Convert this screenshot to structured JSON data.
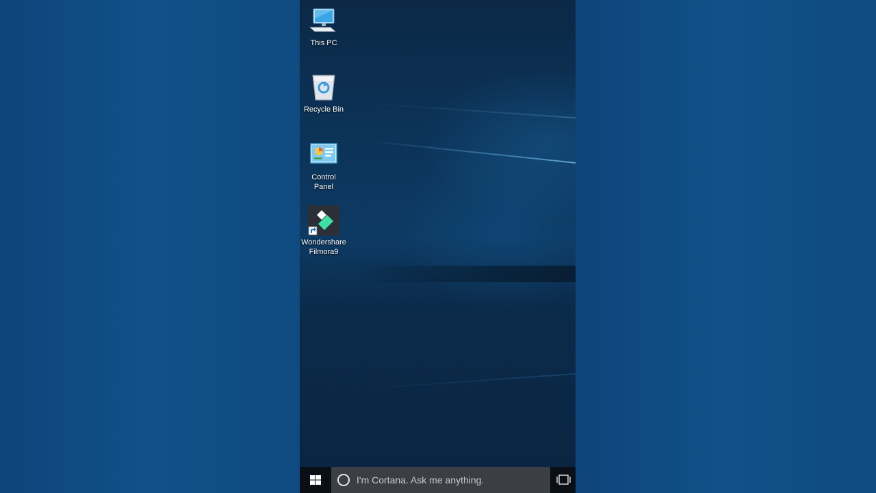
{
  "desktop": {
    "icons": [
      {
        "label": "This PC",
        "icon": "this-pc-icon"
      },
      {
        "label": "Recycle Bin",
        "icon": "recycle-bin-icon"
      },
      {
        "label": "Control\nPanel",
        "icon": "control-panel-icon"
      },
      {
        "label": "Wondershare\nFilmora9",
        "icon": "filmora-icon"
      }
    ]
  },
  "taskbar": {
    "start_icon": "windows-logo-icon",
    "search_placeholder": "I'm Cortana. Ask me anything.",
    "task_view_icon": "task-view-icon"
  },
  "colors": {
    "taskbar_bg": "#0a0f16",
    "search_bg": "#3b3f45",
    "desktop_accent": "#1d6fb0"
  }
}
